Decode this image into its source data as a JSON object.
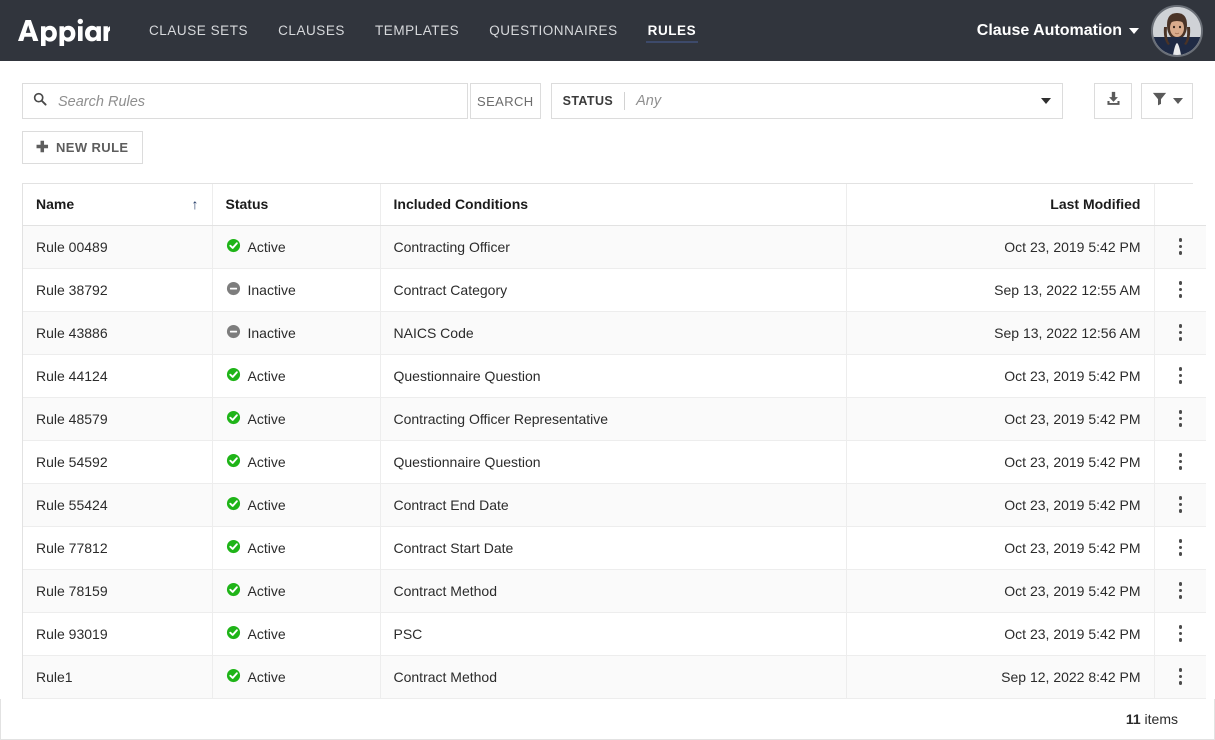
{
  "header": {
    "brand": "appian",
    "brand_icon": "appian-logo",
    "nav": [
      {
        "label": "CLAUSE SETS",
        "active": false
      },
      {
        "label": "CLAUSES",
        "active": false
      },
      {
        "label": "TEMPLATES",
        "active": false
      },
      {
        "label": "QUESTIONNAIRES",
        "active": false
      },
      {
        "label": "RULES",
        "active": true
      }
    ],
    "site_name": "Clause Automation",
    "site_caret_icon": "chevron-down-icon",
    "avatar_icon": "user-avatar-photo",
    "background_color": "#31353d",
    "active_underline_color": "#3d4a6b"
  },
  "toolbar": {
    "search": {
      "icon": "search-icon",
      "value": "",
      "placeholder": "Search Rules"
    },
    "search_button_label": "SEARCH",
    "status_filter": {
      "label": "STATUS",
      "value": "Any",
      "caret_icon": "chevron-down-icon"
    },
    "export_icon": "download-icon",
    "filter_icon": "funnel-icon",
    "filter_caret_icon": "chevron-down-icon",
    "new_rule_label": "NEW RULE",
    "new_rule_icon": "plus-icon"
  },
  "table": {
    "columns": [
      {
        "key": "name",
        "label": "Name",
        "sort": "asc",
        "sort_icon": "sort-ascending-arrow"
      },
      {
        "key": "status",
        "label": "Status"
      },
      {
        "key": "conditions",
        "label": "Included Conditions"
      },
      {
        "key": "modified",
        "label": "Last Modified"
      },
      {
        "key": "menu",
        "label": ""
      }
    ],
    "rows": [
      {
        "name": "Rule 00489",
        "status": "Active",
        "status_icon": "check-circle-icon",
        "conditions": "Contracting Officer",
        "modified": "Oct 23, 2019 5:42 PM",
        "menu_icon": "kebab-menu-icon"
      },
      {
        "name": "Rule 38792",
        "status": "Inactive",
        "status_icon": "minus-circle-icon",
        "conditions": "Contract Category",
        "modified": "Sep 13, 2022 12:55 AM",
        "menu_icon": "kebab-menu-icon"
      },
      {
        "name": "Rule 43886",
        "status": "Inactive",
        "status_icon": "minus-circle-icon",
        "conditions": "NAICS Code",
        "modified": "Sep 13, 2022 12:56 AM",
        "menu_icon": "kebab-menu-icon"
      },
      {
        "name": "Rule 44124",
        "status": "Active",
        "status_icon": "check-circle-icon",
        "conditions": "Questionnaire Question",
        "modified": "Oct 23, 2019 5:42 PM",
        "menu_icon": "kebab-menu-icon"
      },
      {
        "name": "Rule 48579",
        "status": "Active",
        "status_icon": "check-circle-icon",
        "conditions": "Contracting Officer Representative",
        "modified": "Oct 23, 2019 5:42 PM",
        "menu_icon": "kebab-menu-icon"
      },
      {
        "name": "Rule 54592",
        "status": "Active",
        "status_icon": "check-circle-icon",
        "conditions": "Questionnaire Question",
        "modified": "Oct 23, 2019 5:42 PM",
        "menu_icon": "kebab-menu-icon"
      },
      {
        "name": "Rule 55424",
        "status": "Active",
        "status_icon": "check-circle-icon",
        "conditions": "Contract End Date",
        "modified": "Oct 23, 2019 5:42 PM",
        "menu_icon": "kebab-menu-icon"
      },
      {
        "name": "Rule 77812",
        "status": "Active",
        "status_icon": "check-circle-icon",
        "conditions": "Contract Start Date",
        "modified": "Oct 23, 2019 5:42 PM",
        "menu_icon": "kebab-menu-icon"
      },
      {
        "name": "Rule 78159",
        "status": "Active",
        "status_icon": "check-circle-icon",
        "conditions": "Contract Method",
        "modified": "Oct 23, 2019 5:42 PM",
        "menu_icon": "kebab-menu-icon"
      },
      {
        "name": "Rule 93019",
        "status": "Active",
        "status_icon": "check-circle-icon",
        "conditions": "PSC",
        "modified": "Oct 23, 2019 5:42 PM",
        "menu_icon": "kebab-menu-icon"
      },
      {
        "name": "Rule1",
        "status": "Active",
        "status_icon": "check-circle-icon",
        "conditions": "Contract Method",
        "modified": "Sep 12, 2022 8:42 PM",
        "menu_icon": "kebab-menu-icon"
      }
    ],
    "footer": {
      "count": "11",
      "count_suffix": " items"
    },
    "status_colors": {
      "active": "#1fb418",
      "inactive": "#7d7d7d"
    }
  }
}
